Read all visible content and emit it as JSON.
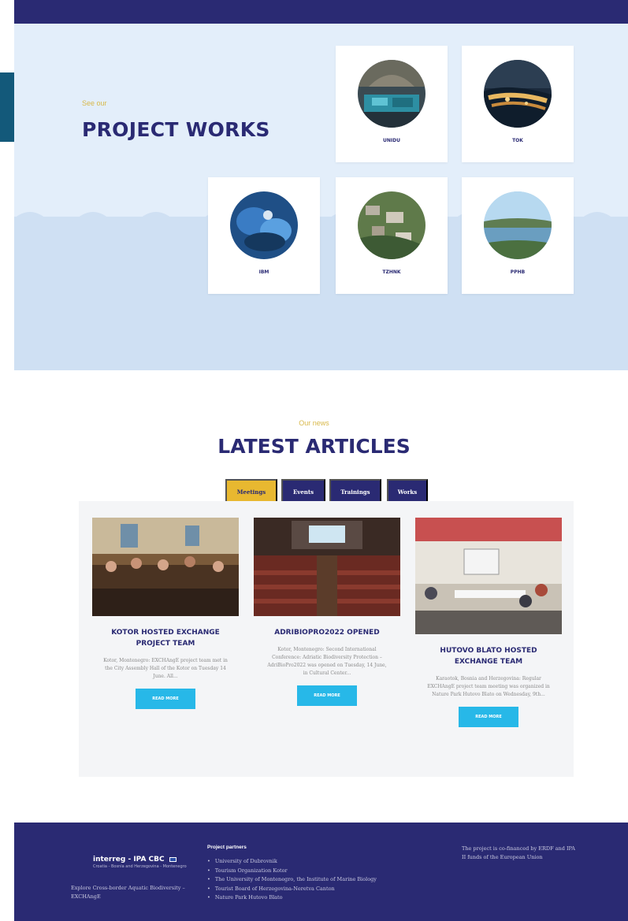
{
  "project_works": {
    "eyebrow": "See our",
    "title": "PROJECT WORKS",
    "cards": [
      {
        "label": "UNIDU"
      },
      {
        "label": "TOK"
      },
      {
        "label": "IBM"
      },
      {
        "label": "TZHNK"
      },
      {
        "label": "PPHB"
      }
    ]
  },
  "news": {
    "eyebrow": "Our news",
    "title": "LATEST ARTICLES",
    "tabs": [
      "Meetings",
      "Events",
      "Trainings",
      "Works"
    ],
    "active_tab": "Meetings",
    "articles": [
      {
        "title": "KOTOR HOSTED EXCHANGE PROJECT TEAM",
        "excerpt": "Kotor, Montenegro: EXCHAngE project team met in the City Assembly Hall of the Kotor on Tuesday 14 June. All...",
        "button": "READ MORE"
      },
      {
        "title": "ADRIBIOPRO2022 OPENED",
        "excerpt": "Kotor, Montenegro: Second International Conference: Adriatic Biodiversity Protection – AdriBioPro2022 was opened on Tuesday, 14 June, in Cultural Center...",
        "button": "READ MORE"
      },
      {
        "title": "HUTOVO BLATO HOSTED EXCHANGE TEAM",
        "excerpt": "Karaotok, Bosnia and Herzegovina: Regular EXCHAngE project team meeting was organized in Nature Park Hutovo Blato on Wednesday, 9th...",
        "button": "READ MORE"
      }
    ]
  },
  "footer": {
    "logo_text": "interreg - IPA CBC",
    "logo_sub": "Croatia - Bosnia and Herzegovina - Montenegro",
    "tagline": "Explore Cross-border Aquatic Biodiversity – EXCHAngE",
    "partners_heading": "Project partners",
    "partners": [
      "University of Dubrovnik",
      "Tourism Organization Kotor",
      "The University of Montenegro, the Institute of Marine Biology",
      "Tourist Board of Herzegovina-Neretva Canton",
      "Nature Park Hutovo Blato"
    ],
    "funding": "The project is co-financed by ERDF and IPA II funds of the European Union"
  },
  "colors": {
    "navy": "#2a2a73",
    "gold": "#e8b830",
    "cyan": "#27b8e8",
    "light_blue": "#e3eefa"
  }
}
